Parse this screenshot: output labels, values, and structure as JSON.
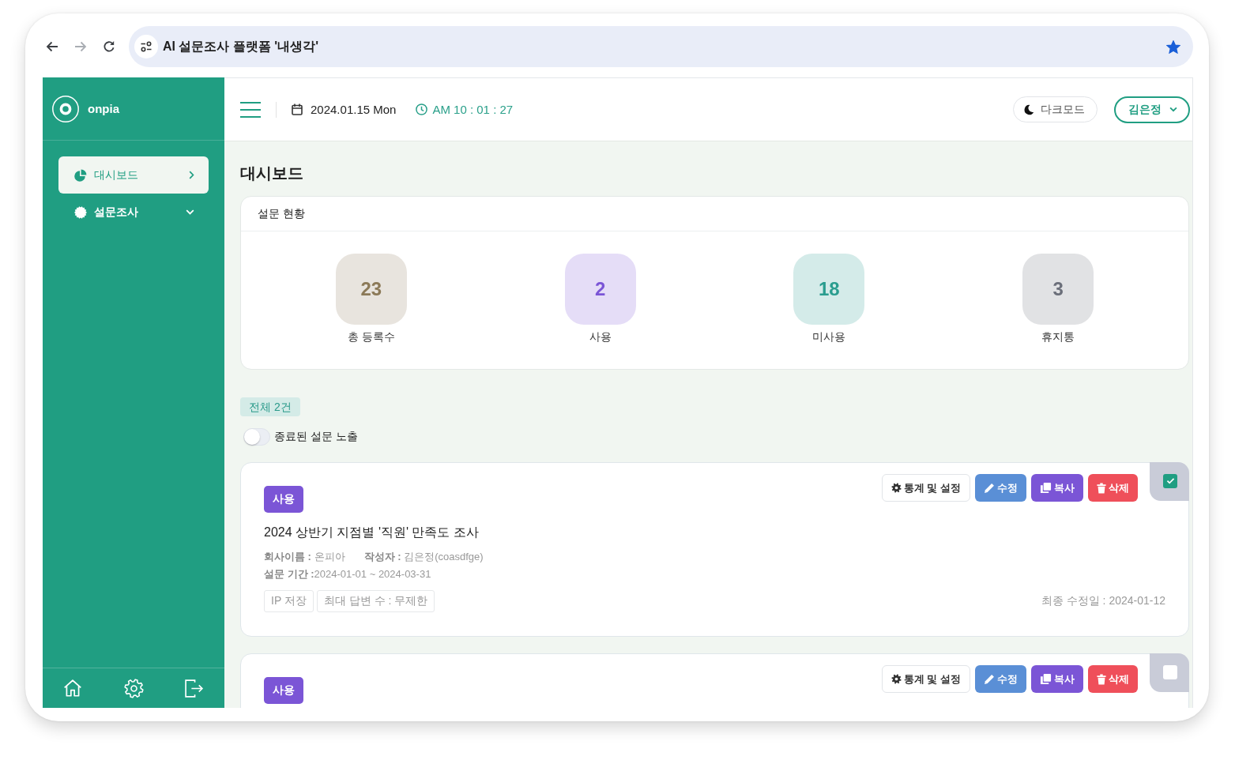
{
  "browser": {
    "nav": [
      {
        "kind": "back",
        "disabled": false
      },
      {
        "kind": "forward",
        "disabled": true
      },
      {
        "kind": "reload",
        "disabled": false
      }
    ],
    "title": "AI 설문조사 플랫폼 '내생각'",
    "bookmarked": true
  },
  "sidebar": {
    "brand": "onpia",
    "items": [
      {
        "label": "대시보드",
        "kind": "link",
        "selected": true
      },
      {
        "label": "설문조사",
        "kind": "group",
        "selected": false
      }
    ]
  },
  "header": {
    "date": "2024.01.15 Mon",
    "time": "AM 10 : 01 : 27",
    "dark_mode": "다크모드",
    "user": "김은정"
  },
  "page_title": "대시보드",
  "stats": {
    "title": "설문 현황",
    "items": [
      {
        "value": "23",
        "label": "총 등록수",
        "color": "#8c7a58"
      },
      {
        "value": "2",
        "label": "사용",
        "color": "#7b55d6"
      },
      {
        "value": "18",
        "label": "미사용",
        "color": "#2a9d8f"
      },
      {
        "value": "3",
        "label": "휴지통",
        "color": "#6b6f7a"
      }
    ]
  },
  "list": {
    "total": "전체 2건",
    "toggle": {
      "label": "종료된 설문 노출",
      "on": false
    },
    "surveys": [
      {
        "status": "사용",
        "title": "2024 상반기 지점별 '직원' 만족도 조사",
        "meta": [
          "**회사이름 :** 온피아",
          "**작성자 :** 김은정(coasdfge)"
        ],
        "period": "**설문 기간 :**2024-01-01 ~ 2024-03-31",
        "tags": [
          "IP 저장",
          "최대 답변 수 : 무제한"
        ],
        "modified": "최종 수정일 : 2024-01-12",
        "actions": [
          {
            "label": "통계 및 설정",
            "kind": "settings"
          },
          {
            "label": "수정",
            "kind": "edit"
          },
          {
            "label": "복사",
            "kind": "copy"
          },
          {
            "label": "삭제",
            "kind": "delete"
          }
        ],
        "checked": true
      },
      {
        "status": "사용",
        "actions": [
          {
            "label": "통계 및 설정",
            "kind": "settings"
          },
          {
            "label": "수정",
            "kind": "edit"
          },
          {
            "label": "복사",
            "kind": "copy"
          },
          {
            "label": "삭제",
            "kind": "delete"
          }
        ],
        "checked": false
      }
    ]
  }
}
